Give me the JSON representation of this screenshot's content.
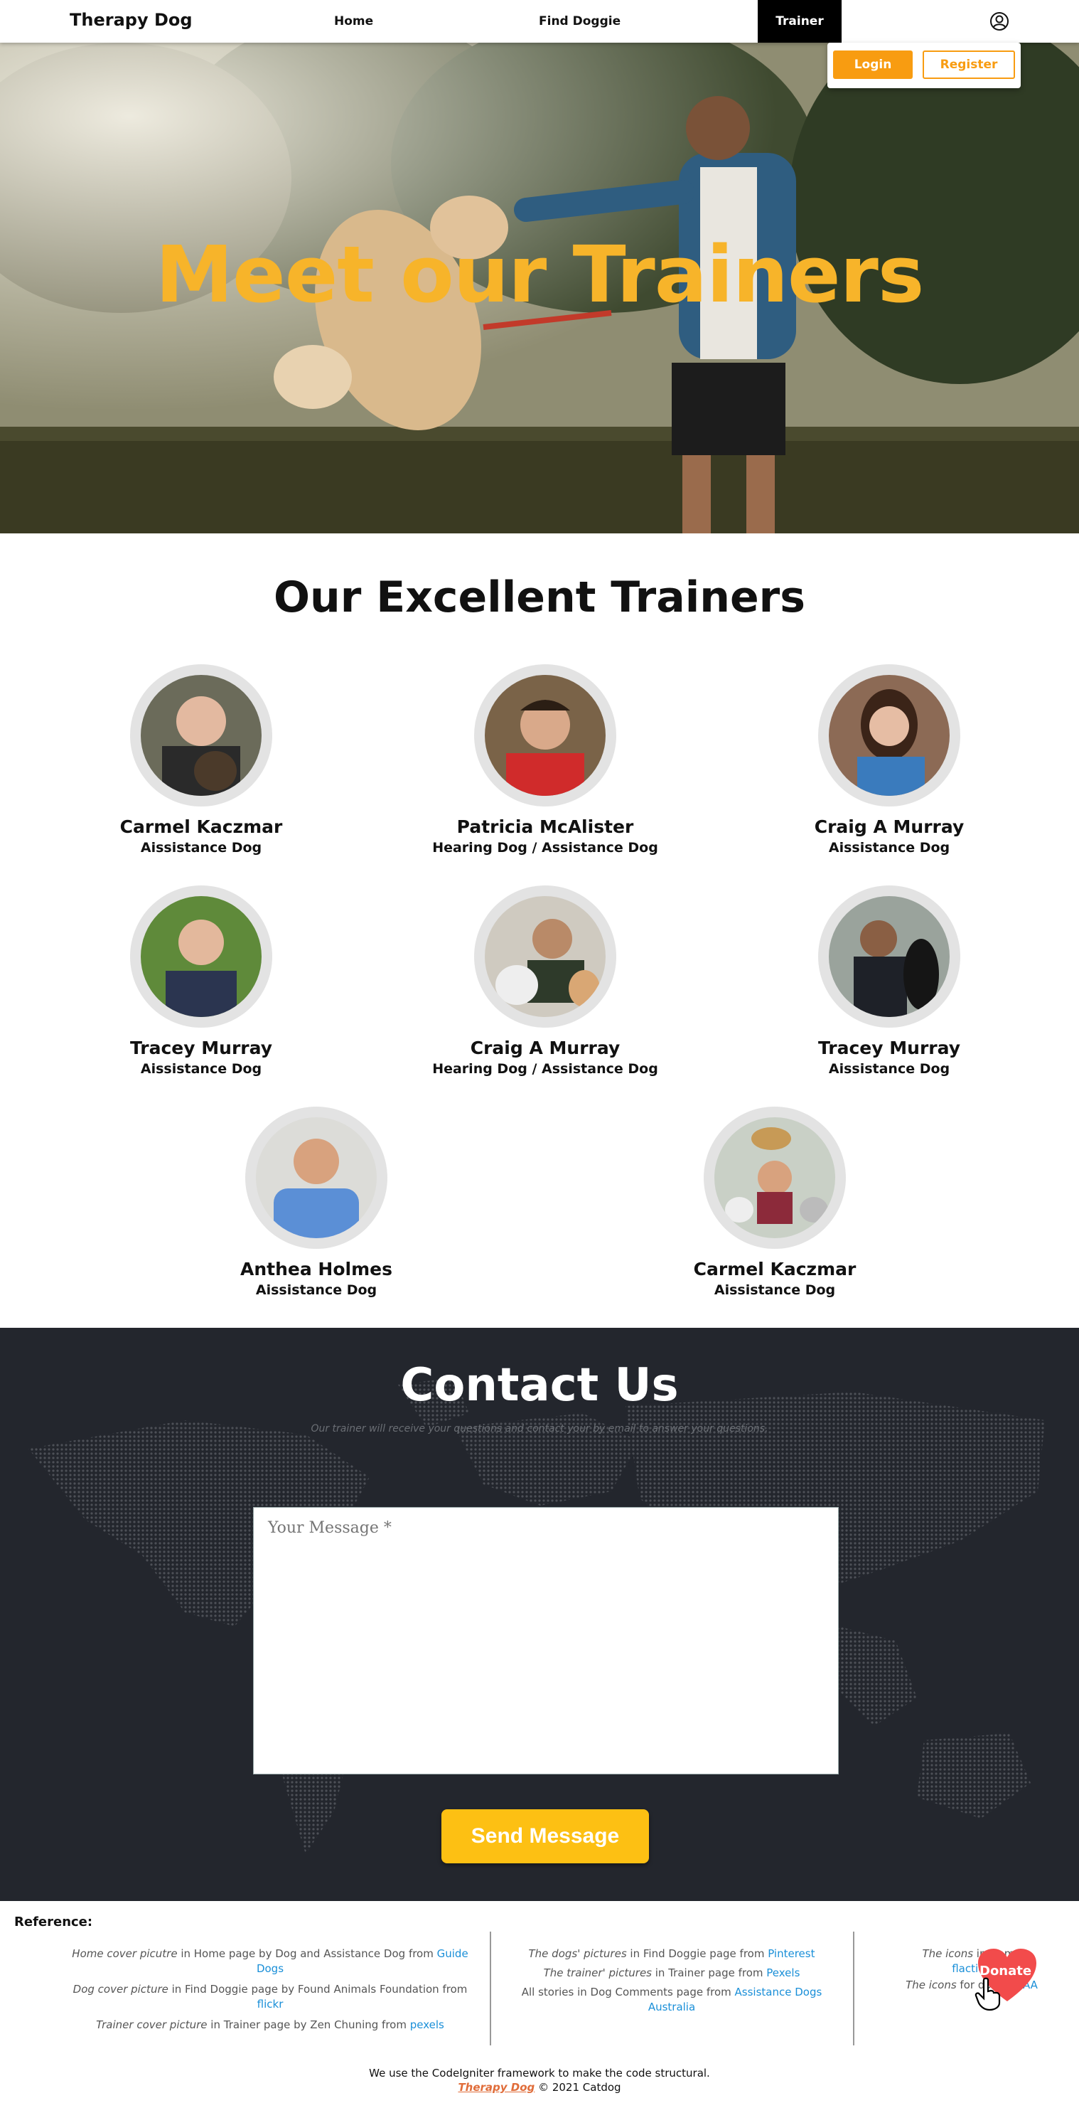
{
  "nav": {
    "brand": "Therapy Dog",
    "links": [
      "Home",
      "Find Doggie",
      "Trainer"
    ],
    "login": "Login",
    "register": "Register"
  },
  "hero": {
    "title": "Meet our Trainers"
  },
  "trainers": {
    "title": "Our Excellent Trainers",
    "items": [
      {
        "name": "Carmel Kaczmar",
        "role": "Aissistance Dog"
      },
      {
        "name": "Patricia McAlister",
        "role": "Hearing Dog / Assistance Dog"
      },
      {
        "name": "Craig A Murray",
        "role": "Aissistance Dog"
      },
      {
        "name": "Tracey Murray",
        "role": "Aissistance Dog"
      },
      {
        "name": "Craig A Murray",
        "role": "Hearing Dog / Assistance Dog"
      },
      {
        "name": "Tracey Murray",
        "role": "Aissistance Dog"
      },
      {
        "name": "Anthea Holmes",
        "role": "Aissistance Dog"
      },
      {
        "name": "Carmel Kaczmar",
        "role": "Aissistance Dog"
      }
    ]
  },
  "contact": {
    "title": "Contact Us",
    "subtitle": "Our trainer will receive your questions and contact your by email to answer your questions.",
    "message_placeholder": "Your Message *",
    "send": "Send Message"
  },
  "reference": {
    "title": "Reference:",
    "col1": [
      {
        "pre": "Home cover picutre",
        "mid": " in Home page by Dog and Assistance Dog from ",
        "link": "Guide Dogs"
      },
      {
        "pre": "Dog cover picture",
        "mid": " in Find Doggie page by Found Animals Foundation from ",
        "link": "flickr"
      },
      {
        "pre": "Trainer cover picture",
        "mid": " in Trainer page by Zen Chuning from ",
        "link": "pexels"
      }
    ],
    "col2": [
      {
        "pre": "The dogs' pictures",
        "mid": " in Find Doggie page from ",
        "link": "Pinterest"
      },
      {
        "pre": "The trainer' pictures",
        "mid": " in Trainer page from ",
        "link": "Pexels"
      },
      {
        "pre": "",
        "mid": "All stories in Dog Comments page from ",
        "link": "Assistance Dogs Australia"
      }
    ],
    "col3": [
      {
        "pre": "The icons",
        "mid": " in Home",
        "link": "flaction"
      },
      {
        "pre": "The icons",
        "mid": " for donat",
        "link": "aAAA"
      }
    ],
    "donate": "Donate"
  },
  "footer": {
    "line1": "We use the CodeIgniter framework to make the code structural.",
    "brand": "Therapy Dog",
    "copyright": " © 2021 Catdog"
  },
  "colors": {
    "accent": "#f89c11",
    "hero_title": "#f7b42a",
    "send": "#fdc013",
    "contact_bg": "#23262d",
    "link": "#1a8fd8"
  }
}
